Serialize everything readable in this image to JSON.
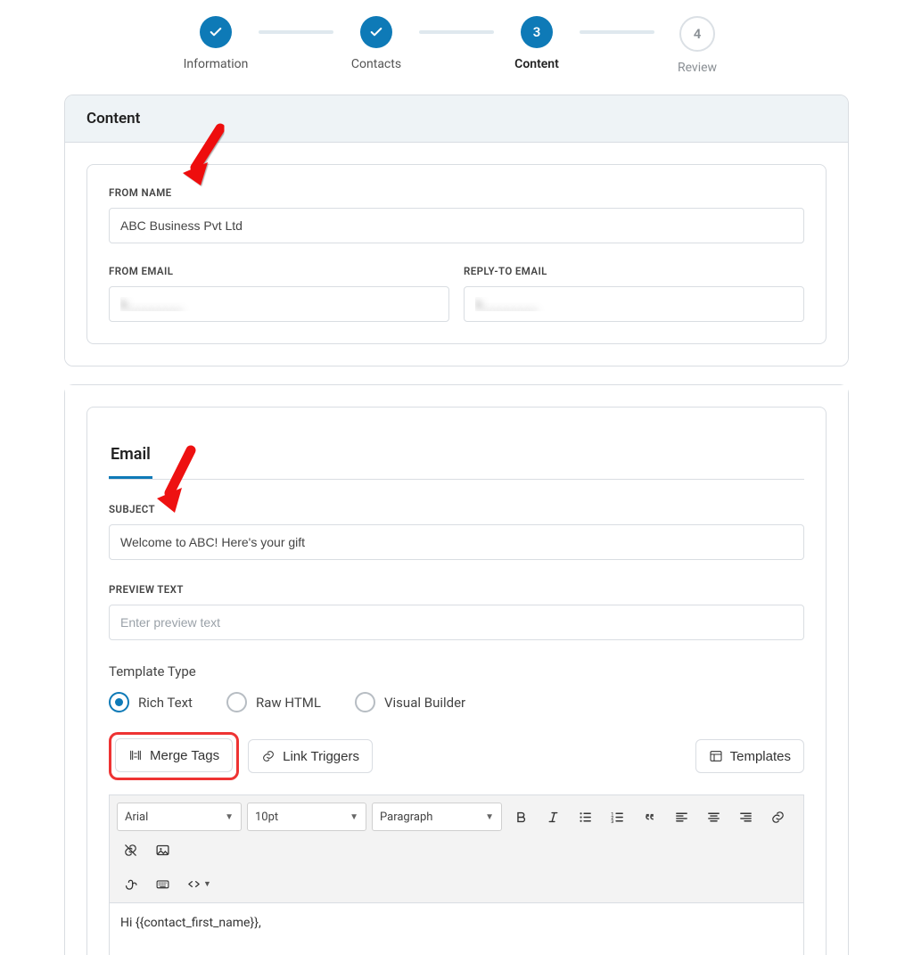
{
  "stepper": {
    "steps": [
      {
        "label": "Information",
        "state": "done"
      },
      {
        "label": "Contacts",
        "state": "done"
      },
      {
        "label": "Content",
        "state": "active",
        "number": "3"
      },
      {
        "label": "Review",
        "state": "inactive",
        "number": "4"
      }
    ]
  },
  "panel": {
    "title": "Content"
  },
  "from": {
    "name_label": "FROM NAME",
    "name_value": "ABC Business Pvt Ltd",
    "email_label": "FROM EMAIL",
    "email_value": "b________",
    "reply_label": "REPLY-TO EMAIL",
    "reply_value": "b________"
  },
  "email": {
    "tab_label": "Email",
    "subject_label": "SUBJECT",
    "subject_value": "Welcome to ABC! Here's your gift",
    "preview_label": "PREVIEW TEXT",
    "preview_placeholder": "Enter preview text",
    "template_type_label": "Template Type",
    "radios": {
      "rich": "Rich Text",
      "raw": "Raw HTML",
      "visual": "Visual Builder"
    },
    "merge_tags": "Merge Tags",
    "link_triggers": "Link Triggers",
    "templates": "Templates",
    "toolbar": {
      "font": "Arial",
      "size": "10pt",
      "block": "Paragraph"
    },
    "body": "Hi {{contact_first_name}},"
  }
}
